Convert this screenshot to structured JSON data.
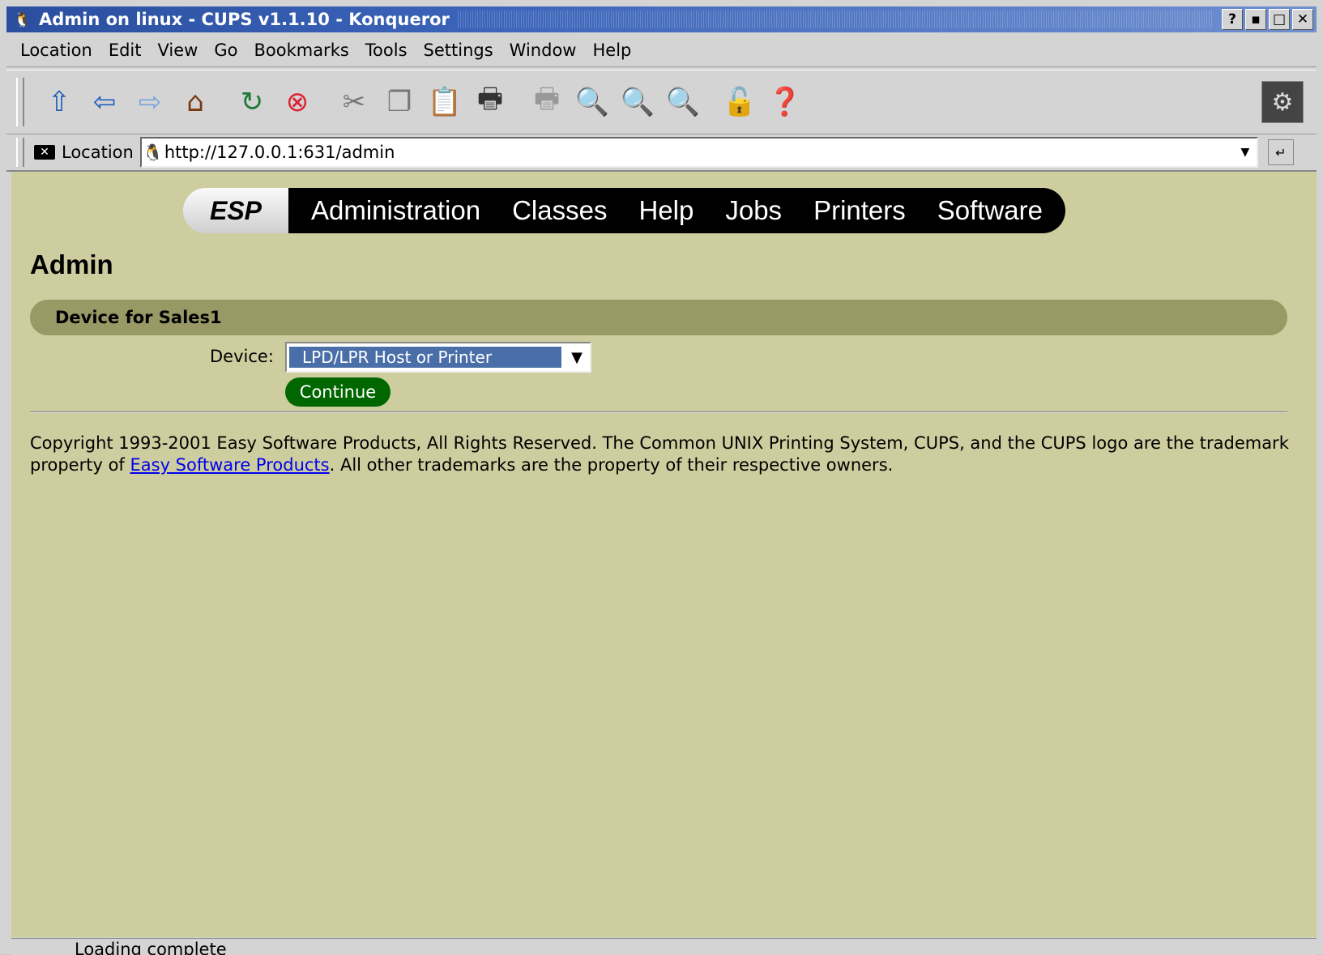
{
  "window": {
    "title": "Admin on linux - CUPS v1.1.10 - Konqueror",
    "buttons": [
      "?",
      "▪",
      "□",
      "✕"
    ]
  },
  "menubar": {
    "items": [
      "Location",
      "Edit",
      "View",
      "Go",
      "Bookmarks",
      "Tools",
      "Settings",
      "Window",
      "Help"
    ]
  },
  "toolbar": {
    "icons": [
      "up-arrow-icon",
      "back-arrow-icon",
      "forward-arrow-icon",
      "home-icon",
      "reload-icon",
      "stop-icon",
      "cut-icon",
      "copy-icon",
      "paste-icon",
      "print-icon",
      "print-frame-icon",
      "zoom-in-icon",
      "zoom-icon",
      "zoom-out-icon",
      "security-lock-icon",
      "help-icon"
    ],
    "throbber_icon": "konqueror-gear-icon"
  },
  "location_bar": {
    "label": "Location",
    "url": "http://127.0.0.1:631/admin"
  },
  "page": {
    "brand": "ESP",
    "nav_tabs": [
      "Administration",
      "Classes",
      "Help",
      "Jobs",
      "Printers",
      "Software"
    ],
    "title": "Admin",
    "section_title": "Device for Sales1",
    "device_label": "Device:",
    "device_value": "LPD/LPR Host or Printer",
    "continue_label": "Continue",
    "copyright_before": "Copyright 1993-2001 Easy Software Products, All Rights Reserved. The Common UNIX Printing System, CUPS, and the CUPS logo are the trademark property of ",
    "copyright_link": "Easy Software Products",
    "copyright_after": ". All other trademarks are the property of their respective owners."
  },
  "statusbar": {
    "text": "Loading complete"
  },
  "colors": {
    "content_bg": "#cdcd9f",
    "section_bar": "#999966",
    "continue_bg": "#006600",
    "link": "#0000ee",
    "title_bar": "#2b4fa0"
  }
}
